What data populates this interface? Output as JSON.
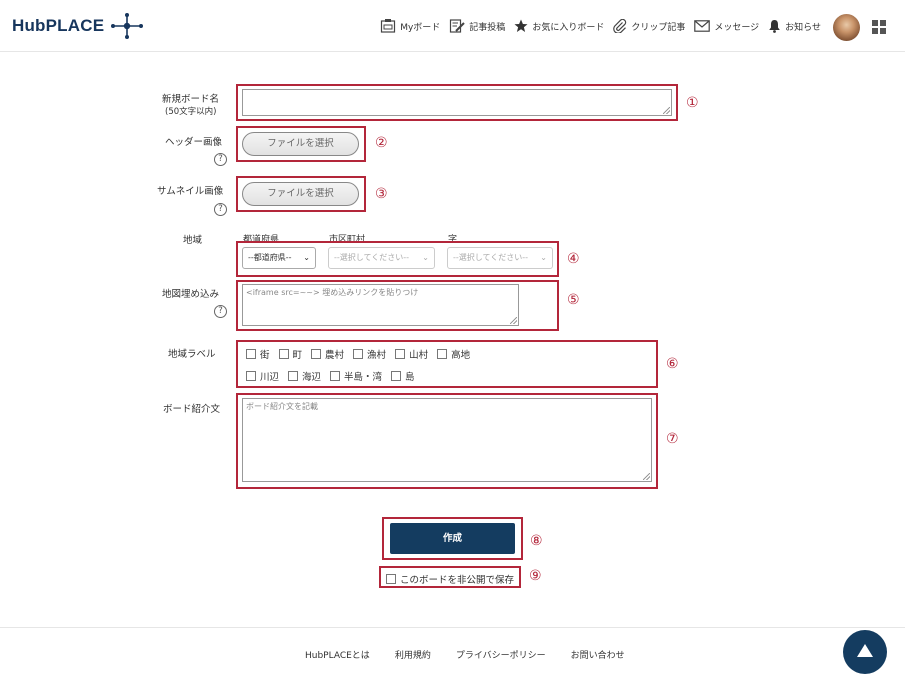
{
  "app": {
    "logo": "HubPLACE"
  },
  "nav": {
    "items": [
      {
        "label": "Myボード",
        "icon": "board-icon"
      },
      {
        "label": "記事投稿",
        "icon": "edit-icon"
      },
      {
        "label": "お気に入りボード",
        "icon": "star-icon"
      },
      {
        "label": "クリップ記事",
        "icon": "paperclip-icon"
      },
      {
        "label": "メッセージ",
        "icon": "mail-icon"
      },
      {
        "label": "お知らせ",
        "icon": "bell-icon"
      }
    ]
  },
  "form": {
    "board_name": {
      "label": "新規ボード名",
      "sub": "(50文字以内)",
      "value": "",
      "marker": "①"
    },
    "header_image": {
      "label": "ヘッダー画像",
      "button": "ファイルを選択",
      "help": "?",
      "marker": "②"
    },
    "thumbnail_image": {
      "label": "サムネイル画像",
      "button": "ファイルを選択",
      "help": "?",
      "marker": "③"
    },
    "region": {
      "label": "地域",
      "col_prefecture": "都道府県",
      "col_city": "市区町村",
      "col_aza": "字",
      "prefecture_value": "--都道府県--",
      "city_value": "--選択してください--",
      "aza_value": "--選択してください--",
      "marker": "④"
    },
    "map_embed": {
      "label": "地図埋め込み",
      "placeholder": "<iframe src=~~> 埋め込みリンクを貼りつけ",
      "help": "?",
      "marker": "⑤"
    },
    "region_label": {
      "label": "地域ラベル",
      "row1": [
        "街",
        "町",
        "農村",
        "漁村",
        "山村",
        "高地"
      ],
      "row2": [
        "川辺",
        "海辺",
        "半島・湾",
        "島"
      ],
      "marker": "⑥"
    },
    "intro": {
      "label": "ボード紹介文",
      "placeholder": "ボード紹介文を記載",
      "marker": "⑦"
    },
    "create_button": {
      "label": "作成",
      "marker": "⑧"
    },
    "private_save": {
      "label": "このボードを非公開で保存",
      "marker": "⑨"
    }
  },
  "footer": {
    "links": [
      "HubPLACEとは",
      "利用規約",
      "プライバシーポリシー",
      "お問い合わせ"
    ]
  },
  "colors": {
    "brand": "#143c60",
    "annotation": "#b3263a"
  }
}
